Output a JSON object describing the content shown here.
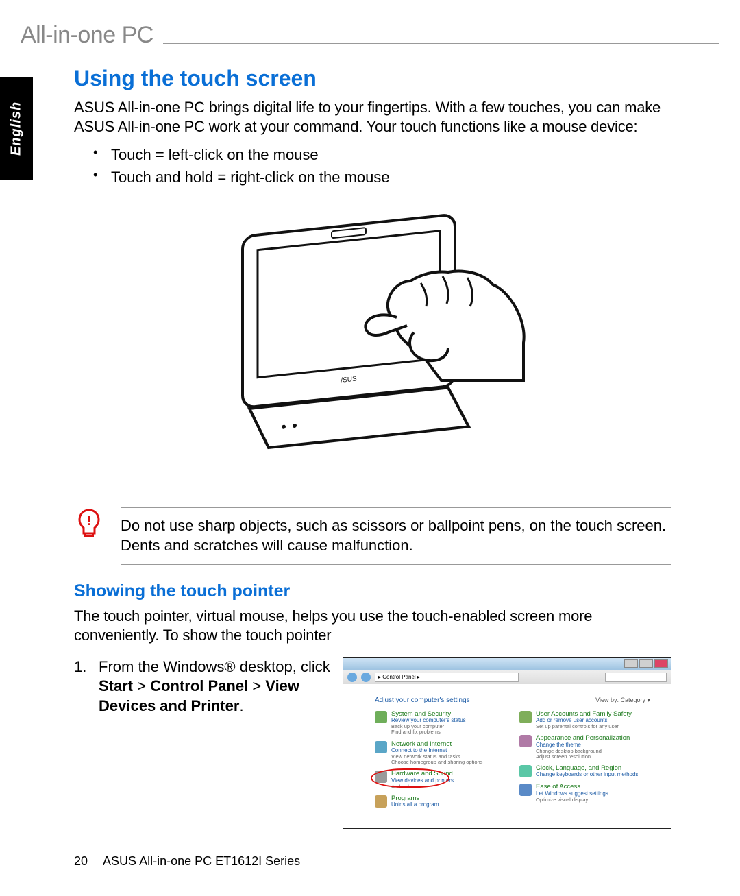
{
  "header": {
    "product_line": "All-in-one PC"
  },
  "lang_tab": "English",
  "section": {
    "title": "Using the touch screen",
    "intro": "ASUS All-in-one PC brings digital life to your fingertips. With a few touches, you can make ASUS All-in-one PC work at your command. Your touch functions like a mouse device:",
    "bullets": [
      "Touch = left-click on the mouse",
      "Touch and hold = right-click on the mouse"
    ]
  },
  "warning": {
    "text": "Do not use sharp objects, such as scissors or ballpoint pens, on the touch screen. Dents and scratches will cause malfunction."
  },
  "subsection": {
    "title": "Showing the touch pointer",
    "intro": "The touch pointer, virtual mouse, helps you use the touch-enabled screen more conveniently. To show the touch pointer"
  },
  "step1": {
    "num": "1.",
    "prefix": "From the Windows® desktop, click ",
    "b1": "Start",
    "sep1": " > ",
    "b2": "Control Panel",
    "sep2": " > ",
    "b3": "View Devices and Printer",
    "suffix": "."
  },
  "screenshot": {
    "address": "▸ Control Panel ▸",
    "adjust": "Adjust your computer's settings",
    "viewby": "View by:   Category ▾",
    "left_col": [
      {
        "title": "System and Security",
        "subs": [
          "Review your computer's status",
          "Back up your computer",
          "Find and fix problems"
        ],
        "ico": "#6fae5a"
      },
      {
        "title": "Network and Internet",
        "subs": [
          "Connect to the Internet",
          "View network status and tasks",
          "Choose homegroup and sharing options"
        ],
        "ico": "#5aa6c7"
      },
      {
        "title": "Hardware and Sound",
        "subs": [
          "View devices and printers",
          "Add a device"
        ],
        "ico": "#9a9a9a",
        "circled": true
      },
      {
        "title": "Programs",
        "subs": [
          "Uninstall a program"
        ],
        "ico": "#c7a15a"
      }
    ],
    "right_col": [
      {
        "title": "User Accounts and Family Safety",
        "subs": [
          "Add or remove user accounts",
          "Set up parental controls for any user"
        ],
        "ico": "#7fae5a"
      },
      {
        "title": "Appearance and Personalization",
        "subs": [
          "Change the theme",
          "Change desktop background",
          "Adjust screen resolution"
        ],
        "ico": "#b07aa6"
      },
      {
        "title": "Clock, Language, and Region",
        "subs": [
          "Change keyboards or other input methods"
        ],
        "ico": "#5ac7a6"
      },
      {
        "title": "Ease of Access",
        "subs": [
          "Let Windows suggest settings",
          "Optimize visual display"
        ],
        "ico": "#5a8ac7"
      }
    ]
  },
  "footer": {
    "page": "20",
    "doc": "ASUS All-in-one PC ET1612I Series"
  }
}
